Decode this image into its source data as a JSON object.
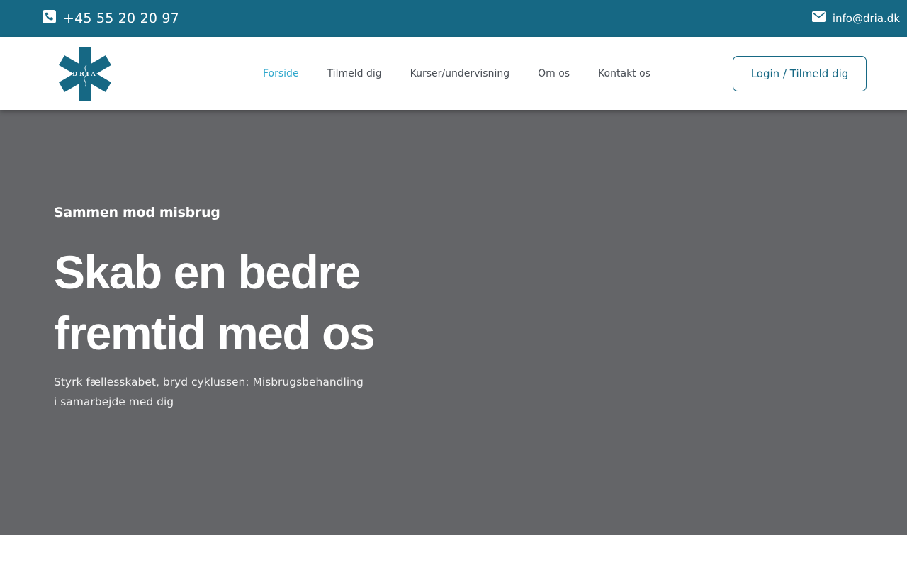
{
  "topbar": {
    "phone": "+45 55 20 20 97",
    "email": "info@dria.dk",
    "phone_icon": "phone-square-icon",
    "email_icon": "envelope-icon"
  },
  "logo": {
    "text": "DRIA",
    "color": "#166884"
  },
  "nav": {
    "items": [
      {
        "label": "Forside",
        "active": true
      },
      {
        "label": "Tilmeld dig",
        "active": false
      },
      {
        "label": "Kurser/undervisning",
        "active": false
      },
      {
        "label": "Om os",
        "active": false
      },
      {
        "label": "Kontakt os",
        "active": false
      }
    ],
    "login_label": "Login / Tilmeld dig"
  },
  "hero": {
    "eyebrow": "Sammen mod misbrug",
    "headline_line1": "Skab en bedre",
    "headline_line2": "fremtid med os",
    "subtext_line1": "Styrk fællesskabet, bryd cyklussen: Misbrugsbehandling",
    "subtext_line2": "i samarbejde med dig"
  },
  "colors": {
    "brand": "#166884",
    "active_link": "#2ea7cc",
    "hero_bg": "#646568"
  }
}
